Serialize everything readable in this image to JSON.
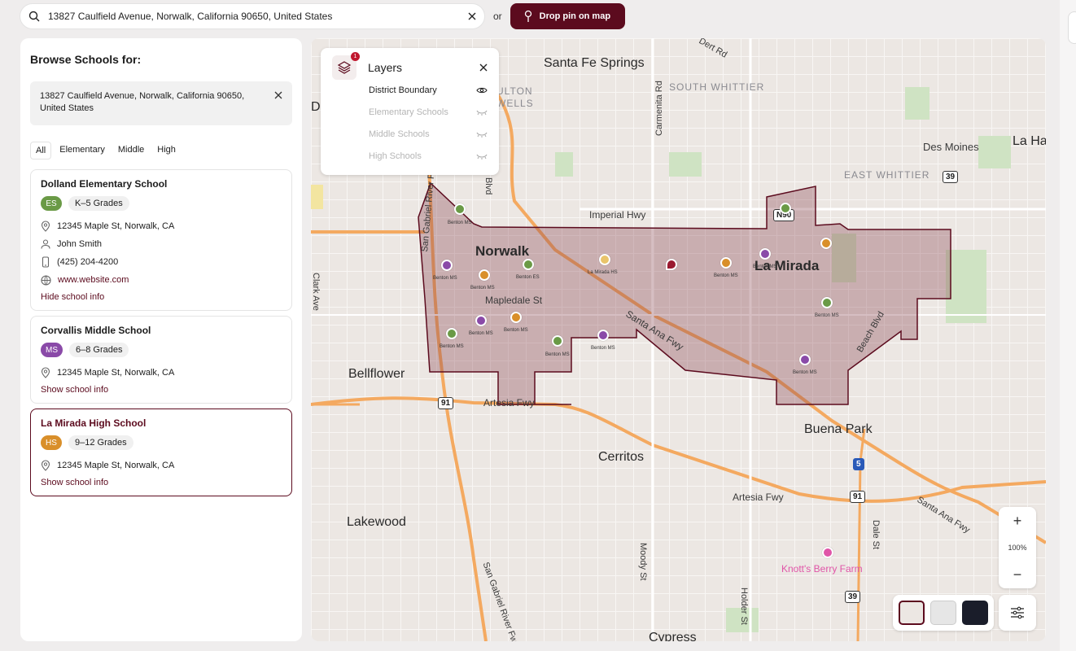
{
  "search": {
    "value": "13827 Caulfield Avenue, Norwalk, California 90650, United States"
  },
  "or_label": "or",
  "drop_pin_label": "Drop pin on map",
  "sidebar": {
    "title": "Browse Schools for:",
    "address": "13827 Caulfield Avenue, Norwalk, California 90650, United States",
    "filters": [
      "All",
      "Elementary",
      "Middle",
      "High"
    ],
    "schools": [
      {
        "name": "Dolland Elementary School",
        "badge": "ES",
        "badge_color": "#6a9a46",
        "grades": "K–5 Grades",
        "address": "12345 Maple St, Norwalk, CA",
        "contact": "John Smith",
        "phone": "(425) 204-4200",
        "website": "www.website.com",
        "toggle": "Hide school info"
      },
      {
        "name": "Corvallis Middle School",
        "badge": "MS",
        "badge_color": "#8a4aa8",
        "grades": "6–8 Grades",
        "address": "12345 Maple St, Norwalk, CA",
        "toggle": "Show school info"
      },
      {
        "name": "La Mirada High School",
        "badge": "HS",
        "badge_color": "#d98f2a",
        "grades": "9–12 Grades",
        "address": "12345 Maple St, Norwalk, CA",
        "toggle": "Show school info"
      }
    ]
  },
  "layers": {
    "title": "Layers",
    "badge_count": "1",
    "items": [
      {
        "label": "District Boundary",
        "visible": true
      },
      {
        "label": "Elementary Schools",
        "visible": false
      },
      {
        "label": "Middle Schools",
        "visible": false
      },
      {
        "label": "High Schools",
        "visible": false
      }
    ]
  },
  "map": {
    "labels": {
      "santa_fe_springs": "Santa Fe Springs",
      "south_whittier": "SOUTH WHITTIER",
      "east_whittier": "EAST WHITTIER",
      "des_moines": "Des Moines",
      "la_ha": "La Ha",
      "norwalk": "Norwalk",
      "la_mirada": "La Mirada",
      "mapledale": "Mapledale St",
      "imperial": "Imperial Hwy",
      "santa_ana_fwy": "Santa Ana Fwy",
      "bellflower": "Bellflower",
      "artesia_fwy_1": "Artesia Fwy",
      "artesia_fwy_2": "Artesia Fwy",
      "buena_park": "Buena Park",
      "cerritos": "Cerritos",
      "lakewood": "Lakewood",
      "knotts": "Knott's Berry Farm",
      "cypress": "Cypress",
      "pioneer": "Pioneer Blvd",
      "carmenita": "Carmenita Rd",
      "clark": "Clark Ave",
      "beach": "Beach Blvd",
      "moody": "Moody St",
      "holder": "Holder St",
      "dale": "Dale St",
      "sg_river_fwy": "San Gabriel River Fwy",
      "sg_river_fwy_2": "San Gabriel River Fwy",
      "santa_ana_fwy_2": "Santa Ana Fwy",
      "ulton": "ULTON",
      "wells": "WELLS",
      "de": "De",
      "dert": "Dert Rd"
    },
    "shields": {
      "r39a": "39",
      "r91a": "91",
      "r91b": "91",
      "r5": "5",
      "r39b": "39",
      "n90": "N90"
    },
    "pin_labels": [
      "Benton MS",
      "Benton MS",
      "Benton MS",
      "Benton ES",
      "Benton MS",
      "La Mirada HS",
      "Benton MS",
      "Benton MS",
      "Benton MS",
      "Benton MS",
      "Benton MS",
      "Benton MS",
      "Benton MS",
      "Benton MS"
    ],
    "zoom_level": "100%",
    "colors": {
      "boundary_fill": "#8a4450",
      "boundary_stroke": "#5c0b1e",
      "accent": "#5c0b1e"
    }
  }
}
